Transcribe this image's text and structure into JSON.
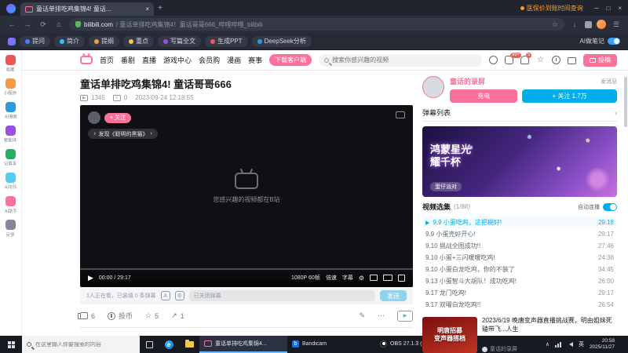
{
  "glyphs": {
    "close": "×",
    "plus": "+",
    "back": "←",
    "forward": "→",
    "reload": "⟳",
    "home": "⌂",
    "star": "☆",
    "star_filled": "★",
    "down": "↓",
    "menu": "☰",
    "minimize": "─",
    "maximize": "□",
    "chev_right": "›",
    "caret_up": "∧",
    "play": "▶",
    "music": "♪",
    "share": "↗",
    "gear": "⚙",
    "pencil": "✎",
    "more": "⋯",
    "danmaku_a": "A"
  },
  "browser": {
    "tab_title": "童话单排吃鸡集锦4! 童话...",
    "ticker": "医保价到账时间查询",
    "address_domain": "bilibili.com",
    "address_path": "/ 童话单排吃鸡集锦4！童话哥哥666_哔哩哔哩_bilibili"
  },
  "ai_toolbar": {
    "buttons": [
      {
        "label": "提问",
        "color": "#4e7bff"
      },
      {
        "label": "简介",
        "color": "#35c3f3"
      },
      {
        "label": "提纲",
        "color": "#f2994a"
      },
      {
        "label": "重点",
        "color": "#f2c94c"
      },
      {
        "label": "写篇全文",
        "color": "#9b51e0"
      },
      {
        "label": "生成PPT",
        "color": "#eb5757"
      },
      {
        "label": "DeepSeek分析",
        "color": "#2d9cdb"
      }
    ],
    "right_label": "AI做笔记"
  },
  "sidebar": {
    "items": [
      {
        "label": "收藏",
        "color": "#eb5757"
      },
      {
        "label": "小程序",
        "color": "#f2994a"
      },
      {
        "label": "AI搜索",
        "color": "#2d9cdb"
      },
      {
        "label": "智能体",
        "color": "#9b51e0"
      },
      {
        "label": "记事本",
        "color": "#27ae60"
      },
      {
        "label": "AI写作",
        "color": "#56ccf2"
      },
      {
        "label": "AI助手",
        "color": "#fb7299"
      },
      {
        "label": "反馈",
        "color": "#828a99"
      }
    ]
  },
  "bili": {
    "nav": [
      "首页",
      "番剧",
      "直播",
      "游戏中心",
      "会员购",
      "漫画",
      "赛事"
    ],
    "download": "下载客户端",
    "search_placeholder": "搜索你感兴趣的视频",
    "badge_msg": "99+",
    "badge_dyn": "5",
    "upload": "投稿"
  },
  "video": {
    "title": "童话单排吃鸡集锦4! 童话哥哥666",
    "views": "1345",
    "danmaku": "0",
    "date": "2023-09-24 12:18:55"
  },
  "player": {
    "follow": "关注",
    "music": "发现《聪明的黑猫》",
    "center_text": "您感兴趣的视频都在B站",
    "time": "00:00 / 29:17",
    "quality": "1080P 60帧",
    "speed": "倍速",
    "subtitle": "字幕"
  },
  "danmaku_bar": {
    "info": "1人正在看，已装填 0 条弹幕",
    "input_value": "已关闭弹幕",
    "send": "发送"
  },
  "actions": {
    "like": "6",
    "coin": "投币",
    "star": "5",
    "share": "1"
  },
  "up": {
    "name": "童话的录屏",
    "message": "发消息",
    "charge": "充电",
    "follow": "+ 关注 1.7万"
  },
  "danmu_panel": {
    "title": "弹幕列表"
  },
  "banner": {
    "line1": "鸿蒙星光",
    "line2": "耀千杯",
    "tag": "蛋仔派对"
  },
  "playlist": {
    "title": "视频选集",
    "count": "(1/88)",
    "autoplay": "自动连播",
    "items": [
      {
        "title": "9.9 小蛋吃鸡，这把糊好!",
        "time": "29:18"
      },
      {
        "title": "9.9 小蛋壳好开心!",
        "time": "29:17"
      },
      {
        "title": "9.10 挑战全图成功!!",
        "time": "27:46"
      },
      {
        "title": "9.10 小蛋+三闪暖暖吃鸡!",
        "time": "24:38"
      },
      {
        "title": "9.10 小蛋白龙吃鸡，你的不装了",
        "time": "34:45"
      },
      {
        "title": "9.13 小蛋智斗大胡队！成功吃鸡!",
        "time": "26:00"
      },
      {
        "title": "9.17 龙门吃鸡!",
        "time": "29:17"
      },
      {
        "title": "9.17 双曜白龙吃鸡!!",
        "time": "26:54"
      }
    ]
  },
  "ad": {
    "image_line1": "明唐招募",
    "image_line2": "变声器搭档",
    "title": "2023/6/19 晚唐变声器直播挑战赛，明由姐妹死磕带飞...人生",
    "uploader": "童话的录屏"
  },
  "taskbar": {
    "search_placeholder": "在这里输入你要搜索的内容",
    "windows": [
      {
        "label": "童话单排吃鸡集锦4..."
      },
      {
        "label": "Bandicam"
      },
      {
        "label": "OBS 27.1.3 (64-bi..."
      }
    ],
    "tray": {
      "ime": "英",
      "time": "20:58",
      "date": "2025/11/27"
    }
  }
}
